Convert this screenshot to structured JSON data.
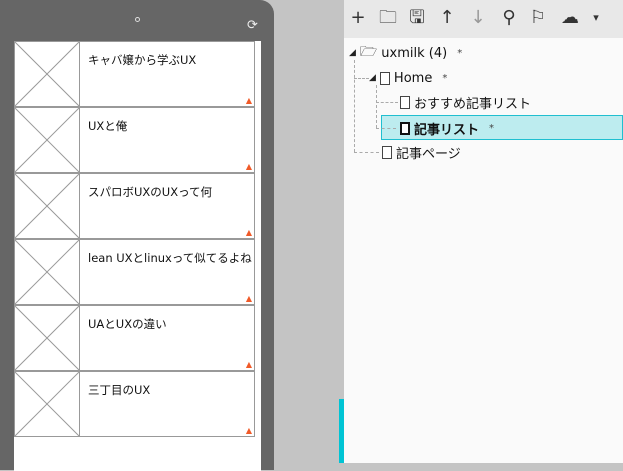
{
  "phone": {
    "items": [
      {
        "title": "キャバ嬢から学ぶUX"
      },
      {
        "title": "UXと俺"
      },
      {
        "title": "スパロボUXのUXって何"
      },
      {
        "title": "lean UXとlinuxって似てるよね"
      },
      {
        "title": "UAとUXの違い"
      },
      {
        "title": "三丁目のUX"
      }
    ]
  },
  "toolbar": [
    {
      "icon": "plus-icon",
      "glyph": "+"
    },
    {
      "icon": "folder-icon",
      "glyph": "🗀"
    },
    {
      "icon": "save-icon",
      "glyph": "🖫"
    },
    {
      "icon": "arrow-up-icon",
      "glyph": "↑"
    },
    {
      "icon": "arrow-down-icon",
      "glyph": "↓"
    },
    {
      "icon": "search-icon",
      "glyph": "⚲"
    },
    {
      "icon": "flag-icon",
      "glyph": "⚐"
    },
    {
      "icon": "cloud-icon",
      "glyph": "☁"
    },
    {
      "icon": "caret-down-icon",
      "glyph": "▾"
    }
  ],
  "tree": {
    "root": "uxmilk (4)",
    "home": "Home",
    "recommended": "おすすめ記事リスト",
    "article_list": "記事リスト",
    "article_page": "記事ページ",
    "modified_marker": "*"
  },
  "colors": {
    "accent": "#00c4d4",
    "selection": "#bdecef"
  }
}
